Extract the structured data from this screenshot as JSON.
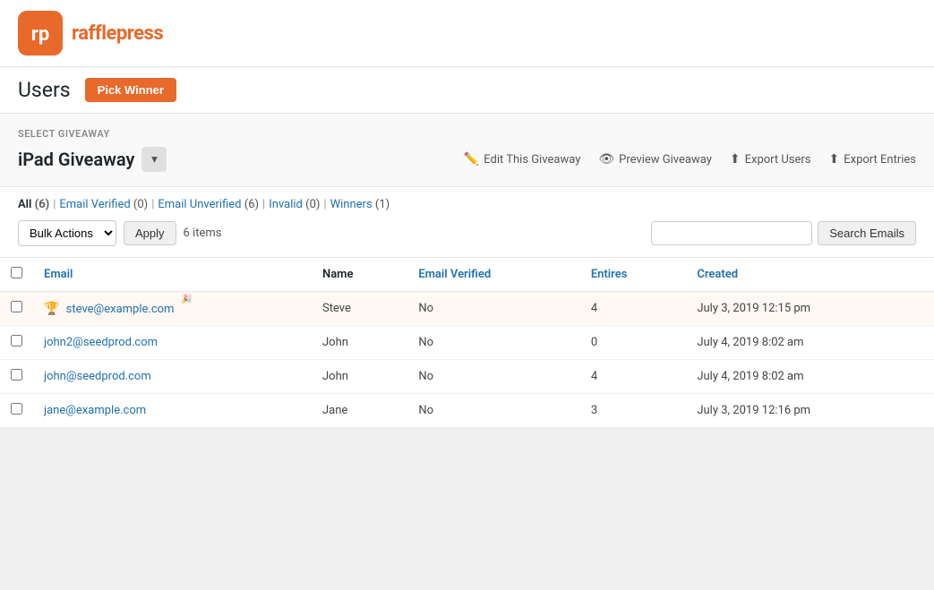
{
  "logo": {
    "text": "rafflepress"
  },
  "header": {
    "page_title": "Users",
    "pick_winner_label": "Pick Winner"
  },
  "select_giveaway": {
    "label": "SELECT GIVEAWAY",
    "name": "iPad Giveaway"
  },
  "actions": {
    "edit_label": "Edit This Giveaway",
    "preview_label": "Preview Giveaway",
    "export_users_label": "Export Users",
    "export_entries_label": "Export Entries"
  },
  "filters": {
    "all_label": "All",
    "all_count": "(6)",
    "email_verified_label": "Email Verified",
    "email_verified_count": "(0)",
    "email_unverified_label": "Email Unverified",
    "email_unverified_count": "(6)",
    "invalid_label": "Invalid",
    "invalid_count": "(0)",
    "winners_label": "Winners",
    "winners_count": "(1)"
  },
  "bulk": {
    "label": "Bulk Actions",
    "apply_label": "Apply"
  },
  "search": {
    "placeholder": "",
    "button_label": "Search Emails"
  },
  "items_count": "6 items",
  "table": {
    "columns": [
      "Email",
      "Name",
      "Email Verified",
      "Entires",
      "Created"
    ],
    "rows": [
      {
        "id": 1,
        "email": "steve@example.com",
        "name": "Steve",
        "email_verified": "No",
        "entries": "4",
        "created": "July 3, 2019 12:15 pm",
        "is_winner": true
      },
      {
        "id": 2,
        "email": "john2@seedprod.com",
        "name": "John",
        "email_verified": "No",
        "entries": "0",
        "created": "July 4, 2019 8:02 am",
        "is_winner": false
      },
      {
        "id": 3,
        "email": "john@seedprod.com",
        "name": "John",
        "email_verified": "No",
        "entries": "4",
        "created": "July 4, 2019 8:02 am",
        "is_winner": false
      },
      {
        "id": 4,
        "email": "jane@example.com",
        "name": "Jane",
        "email_verified": "No",
        "entries": "3",
        "created": "July 3, 2019 12:16 pm",
        "is_winner": false
      }
    ]
  }
}
